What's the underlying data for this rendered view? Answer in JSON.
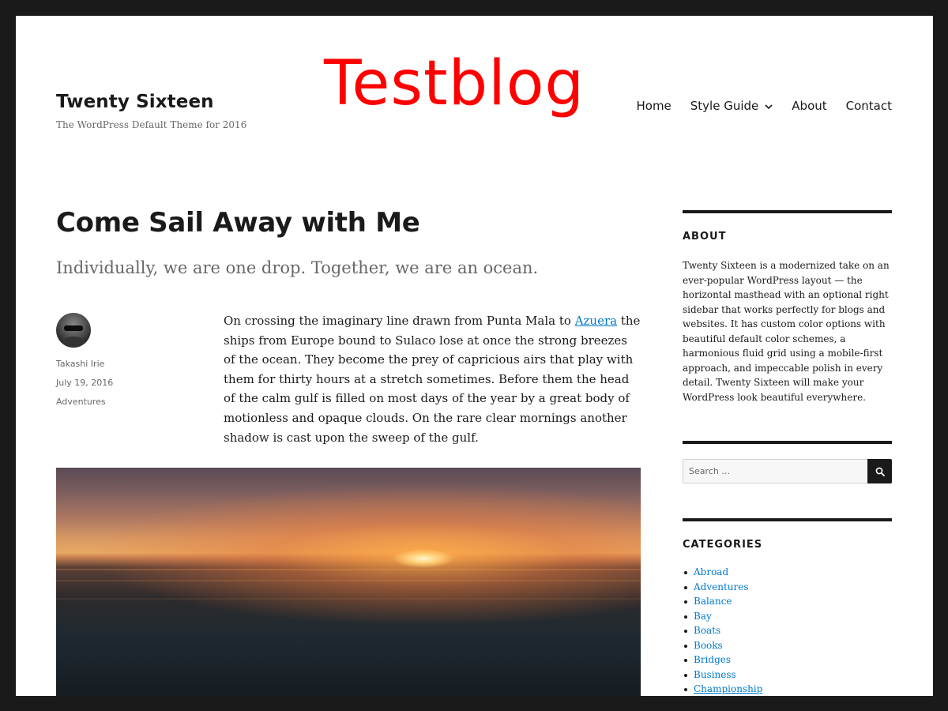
{
  "header": {
    "site_title": "Twenty Sixteen",
    "site_description": "The WordPress Default Theme for 2016",
    "overlay_title": "Testblog",
    "overlay_color": "#ff0000"
  },
  "nav": {
    "items": [
      {
        "label": "Home"
      },
      {
        "label": "Style Guide",
        "has_submenu": true
      },
      {
        "label": "About"
      },
      {
        "label": "Contact"
      }
    ]
  },
  "post": {
    "title": "Come Sail Away with Me",
    "excerpt": "Individually, we are one drop. Together, we are an ocean.",
    "author": "Takashi Irie",
    "date": "July 19, 2016",
    "category": "Adventures",
    "content_before_link": "On crossing the imaginary line drawn from Punta Mala to ",
    "content_link": "Azuera",
    "content_after_link": " the ships from Europe bound to Sulaco lose at once the strong breezes of the ocean. They become the prey of capricious airs that play with them for thirty hours at a stretch sometimes. Before them the head of the calm gulf is filled on most days of the year by a great body of motionless and opaque clouds. On the rare clear mornings another shadow is cast upon the sweep of the gulf."
  },
  "sidebar": {
    "about": {
      "title": "ABOUT",
      "text": "Twenty Sixteen is a modernized take on an ever-popular WordPress layout — the horizontal masthead with an optional right sidebar that works perfectly for blogs and websites. It has custom color options with beautiful default color schemes, a harmonious fluid grid using a mobile-first approach, and impeccable polish in every detail. Twenty Sixteen will make your WordPress look beautiful everywhere."
    },
    "search": {
      "placeholder": "Search …"
    },
    "categories": {
      "title": "CATEGORIES",
      "items": [
        "Abroad",
        "Adventures",
        "Balance",
        "Bay",
        "Boats",
        "Books",
        "Bridges",
        "Business",
        "Championship"
      ]
    }
  },
  "colors": {
    "text": "#1a1a1a",
    "muted": "#686868",
    "link": "#007acc",
    "frame": "#1a1a1a"
  }
}
